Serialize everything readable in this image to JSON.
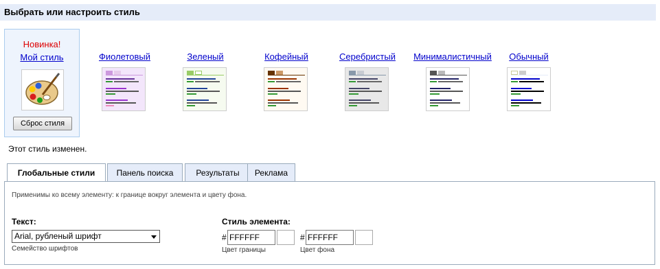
{
  "header": {
    "title": "Выбрать или настроить стиль"
  },
  "styles": {
    "my_style": {
      "new_label": "Новинка!",
      "label": "Мой стиль",
      "reset_label": "Сброс стиля",
      "icon": "palette-icon"
    },
    "violet": {
      "label": "Фиолетовый",
      "colors": {
        "bg": "#f3e6fb",
        "accent": "#cc99dd",
        "link": "#9933cc"
      }
    },
    "green": {
      "label": "Зеленый",
      "colors": {
        "bg": "#f6fbf0",
        "accent": "#99cc66",
        "link": "#339933"
      }
    },
    "coffee": {
      "label": "Кофейный",
      "colors": {
        "bg": "#fffaf2",
        "accent": "#663300",
        "link": "#993300"
      }
    },
    "silver": {
      "label": "Серебристый",
      "colors": {
        "bg": "#e8e8e8",
        "accent": "#8899aa",
        "link": "#444466"
      }
    },
    "minimal": {
      "label": "Минималистичный",
      "colors": {
        "bg": "#ffffff",
        "accent": "#555555",
        "link": "#222266"
      }
    },
    "plain": {
      "label": "Обычный",
      "colors": {
        "bg": "#ffffff",
        "accent": "#e5ecf9",
        "link": "#0000cc"
      }
    }
  },
  "status": "Этот стиль изменен.",
  "tabs": [
    {
      "label": "Глобальные стили",
      "active": true
    },
    {
      "label": "Панель поиска",
      "active": false
    },
    {
      "label": "Результаты",
      "active": false
    },
    {
      "label": "Реклама",
      "active": false
    }
  ],
  "panel": {
    "hint": "Применимы ко всему элементу: к границе вокруг элемента и цвету фона.",
    "text_label": "Текст:",
    "font_value": "Arial, рубленый шрифт",
    "font_caption": "Семейство шрифтов",
    "element_style_label": "Стиль элемента:",
    "hash": "#",
    "border_value": "FFFFFF",
    "border_caption": "Цвет границы",
    "bg_value": "FFFFFF",
    "bg_caption": "Цвет фона"
  }
}
